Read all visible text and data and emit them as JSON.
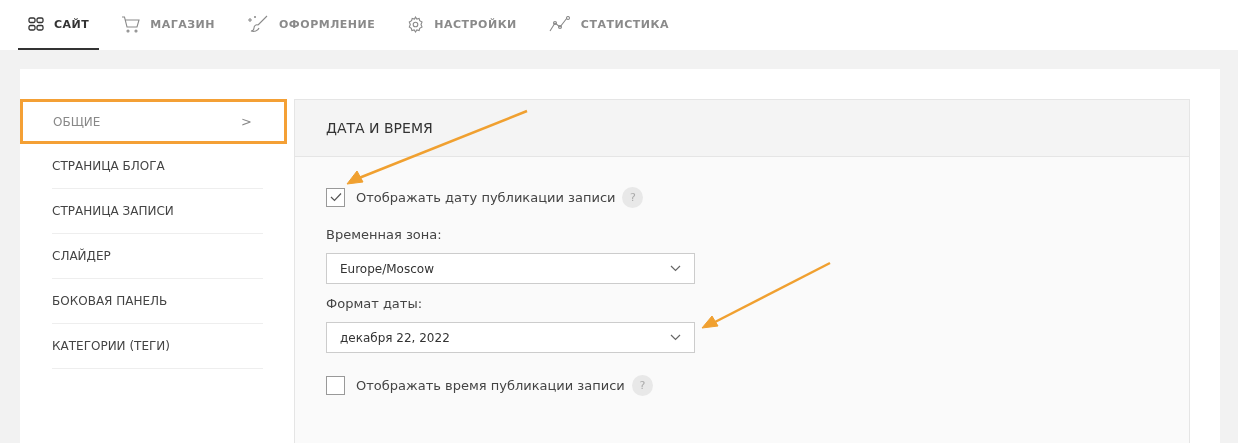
{
  "tabs": [
    {
      "label": "САЙТ",
      "kind": "grid",
      "selected": true
    },
    {
      "label": "МАГАЗИН",
      "kind": "cart",
      "selected": false
    },
    {
      "label": "ОФОРМЛЕНИЕ",
      "kind": "brush",
      "selected": false
    },
    {
      "label": "НАСТРОЙКИ",
      "kind": "gear",
      "selected": false
    },
    {
      "label": "СТАТИСТИКА",
      "kind": "chart",
      "selected": false
    }
  ],
  "sidebar": {
    "items": [
      {
        "label": "ОБЩИЕ",
        "selected": true,
        "chevron": ">"
      },
      {
        "label": "СТРАНИЦА БЛОГА",
        "selected": false
      },
      {
        "label": "СТРАНИЦА ЗАПИСИ",
        "selected": false
      },
      {
        "label": "СЛАЙДЕР",
        "selected": false
      },
      {
        "label": "БОКОВАЯ ПАНЕЛЬ",
        "selected": false
      },
      {
        "label": "КАТЕГОРИИ (ТЕГИ)",
        "selected": false
      }
    ]
  },
  "panel": {
    "title": "ДАТА И ВРЕМЯ",
    "fields": [
      {
        "kind": "checkbox",
        "label": "Отображать дату публикации записи",
        "checked": true,
        "help": "?"
      },
      {
        "kind": "select",
        "label": "Временная зона:",
        "value": "Europe/Moscow"
      },
      {
        "kind": "select",
        "label": "Формат даты:",
        "value": "декабря 22, 2022"
      },
      {
        "kind": "checkbox",
        "label": "Отображать время публикации записи",
        "checked": false,
        "help": "?"
      }
    ]
  }
}
